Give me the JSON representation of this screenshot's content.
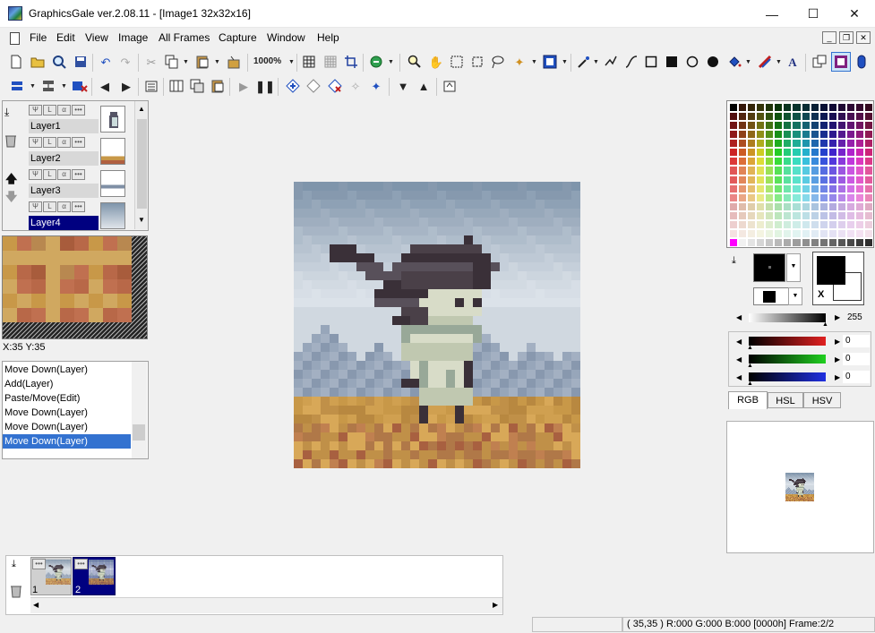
{
  "window": {
    "title": "GraphicsGale ver.2.08.11 - [Image1 32x32x16]",
    "minimize_glyph": "—",
    "maximize_glyph": "☐",
    "close_glyph": "✕"
  },
  "menu": {
    "items": [
      "File",
      "Edit",
      "View",
      "Image",
      "All Frames",
      "Capture",
      "Window",
      "Help"
    ]
  },
  "toolbar": {
    "zoom_label": "1000%"
  },
  "layers": {
    "items": [
      {
        "name": "Layer1"
      },
      {
        "name": "Layer2"
      },
      {
        "name": "Layer3"
      },
      {
        "name": "Layer4",
        "selected": true
      }
    ],
    "btn_labels": [
      "Ψ",
      "L",
      "α",
      "•••"
    ]
  },
  "cursor": {
    "coords_text": "X:35 Y:35"
  },
  "history": {
    "items": [
      {
        "label": "Move Down(Layer)"
      },
      {
        "label": "Add(Layer)"
      },
      {
        "label": "Paste/Move(Edit)"
      },
      {
        "label": "Move Down(Layer)"
      },
      {
        "label": "Move Down(Layer)"
      },
      {
        "label": "Move Down(Layer)",
        "selected": true
      }
    ]
  },
  "color_panel": {
    "alpha_value": "255",
    "red_value": "0",
    "green_value": "0",
    "blue_value": "0",
    "tabs": [
      "RGB",
      "HSL",
      "HSV"
    ],
    "active_tab": "RGB",
    "swap_label": "X",
    "fg_color": "#000000",
    "bg_color": "#ffffff"
  },
  "frames": {
    "items": [
      {
        "number": "1"
      },
      {
        "number": "2",
        "selected": true
      }
    ]
  },
  "status": {
    "text": "( 35,35 ) R:000 G:000 B:000  [0000h]  Frame:2/2"
  },
  "colors": {
    "selection": "#3372d0",
    "layer_selected": "#000080",
    "sky_top": "#7f95ab",
    "ground": "#c89848"
  }
}
